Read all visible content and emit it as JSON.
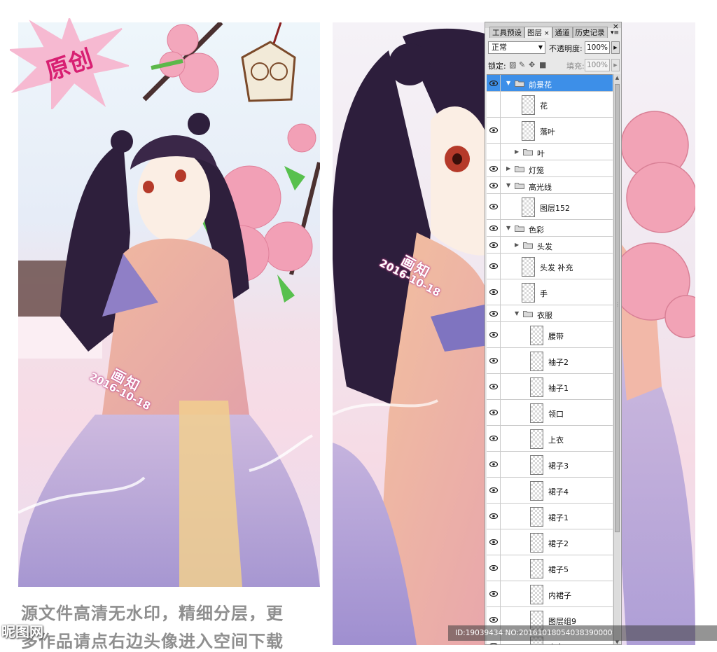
{
  "stamp": {
    "text": "原创"
  },
  "artwork": {
    "watermark_title": "画知",
    "watermark_date": "2016-10-18"
  },
  "caption": {
    "line1": "源文件高清无水印，精细分层，更",
    "line2": "多作品请点右边头像进入空间下载"
  },
  "site": {
    "logo": "昵图网",
    "id_text": "ID:19039434 NO:20161018054038390000"
  },
  "panel": {
    "tabs": [
      {
        "label": "工具预设",
        "active": false
      },
      {
        "label": "图层",
        "active": true,
        "close": "×"
      },
      {
        "label": "通道",
        "active": false
      },
      {
        "label": "历史记录",
        "active": false
      }
    ],
    "close_glyph": "×",
    "menu_glyph": "▾≡",
    "blend_mode": "正常",
    "opacity_label": "不透明度:",
    "opacity_value": "100%",
    "lock_label": "锁定:",
    "fill_label": "填充:",
    "fill_value": "100%",
    "layers": [
      {
        "name": "前景花",
        "type": "group",
        "expanded": true,
        "visible": true,
        "selected": true,
        "indent": 0
      },
      {
        "name": "花",
        "type": "layer",
        "visible": false,
        "indent": 1
      },
      {
        "name": "落叶",
        "type": "layer",
        "visible": true,
        "indent": 1
      },
      {
        "name": "叶",
        "type": "group",
        "expanded": false,
        "visible": false,
        "indent": 1
      },
      {
        "name": "灯笼",
        "type": "group",
        "expanded": false,
        "visible": true,
        "indent": 0
      },
      {
        "name": "高光线",
        "type": "group",
        "expanded": true,
        "visible": true,
        "indent": 0
      },
      {
        "name": "图层152",
        "type": "layer",
        "visible": true,
        "indent": 1
      },
      {
        "name": "色彩",
        "type": "group",
        "expanded": true,
        "visible": true,
        "indent": 0
      },
      {
        "name": "头发",
        "type": "group",
        "expanded": false,
        "visible": true,
        "indent": 1
      },
      {
        "name": "头发 补充",
        "type": "layer",
        "visible": true,
        "indent": 1
      },
      {
        "name": "手",
        "type": "layer",
        "visible": true,
        "indent": 1
      },
      {
        "name": "衣服",
        "type": "group",
        "expanded": true,
        "visible": true,
        "indent": 1
      },
      {
        "name": "腰带",
        "type": "layer",
        "visible": true,
        "indent": 2
      },
      {
        "name": "袖子2",
        "type": "layer",
        "visible": true,
        "indent": 2
      },
      {
        "name": "袖子1",
        "type": "layer",
        "visible": true,
        "indent": 2
      },
      {
        "name": "领口",
        "type": "layer",
        "visible": true,
        "indent": 2
      },
      {
        "name": "上衣",
        "type": "layer",
        "visible": true,
        "indent": 2
      },
      {
        "name": "裙子3",
        "type": "layer",
        "visible": true,
        "indent": 2
      },
      {
        "name": "裙子4",
        "type": "layer",
        "visible": true,
        "indent": 2
      },
      {
        "name": "裙子1",
        "type": "layer",
        "visible": true,
        "indent": 2
      },
      {
        "name": "裙子2",
        "type": "layer",
        "visible": true,
        "indent": 2
      },
      {
        "name": "裙子5",
        "type": "layer",
        "visible": true,
        "indent": 2
      },
      {
        "name": "内裙子",
        "type": "layer",
        "visible": true,
        "indent": 2
      },
      {
        "name": "图层组9",
        "type": "layer",
        "visible": true,
        "indent": 2
      },
      {
        "name": "内衣",
        "type": "layer",
        "visible": true,
        "indent": 2
      }
    ]
  }
}
